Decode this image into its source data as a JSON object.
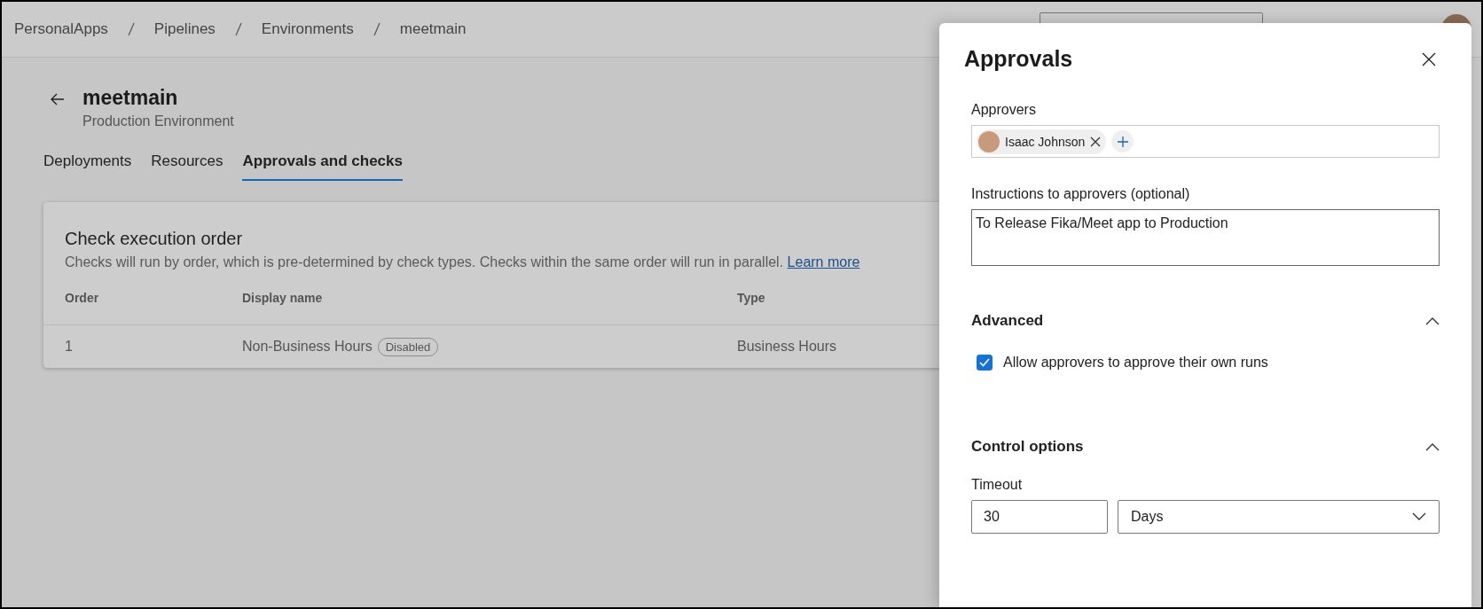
{
  "breadcrumb": [
    "PersonalApps",
    "Pipelines",
    "Environments",
    "meetmain"
  ],
  "page": {
    "title": "meetmain",
    "subtitle": "Production Environment"
  },
  "tabs": [
    {
      "label": "Deployments",
      "selected": false
    },
    {
      "label": "Resources",
      "selected": false
    },
    {
      "label": "Approvals and checks",
      "selected": true
    }
  ],
  "card": {
    "title": "Check execution order",
    "description": "Checks will run by order, which is pre-determined by check types. Checks within the same order will run in parallel.",
    "link": "Learn more",
    "columns": [
      "Order",
      "Display name",
      "Type"
    ],
    "rows": [
      {
        "order": "1",
        "display_name": "Non-Business Hours",
        "badge": "Disabled",
        "type": "Business Hours"
      }
    ]
  },
  "panel": {
    "title": "Approvals",
    "approvers_label": "Approvers",
    "approvers": [
      {
        "name": "Isaac Johnson"
      }
    ],
    "instructions_label": "Instructions to approvers (optional)",
    "instructions_value": "To Release Fika/Meet app to Production",
    "advanced": {
      "title": "Advanced",
      "expanded": true,
      "option": {
        "label": "Allow approvers to approve their own runs",
        "checked": true
      }
    },
    "control_options": {
      "title": "Control options",
      "expanded": true,
      "timeout": {
        "label": "Timeout",
        "value": "30",
        "unit": "Days"
      }
    }
  }
}
